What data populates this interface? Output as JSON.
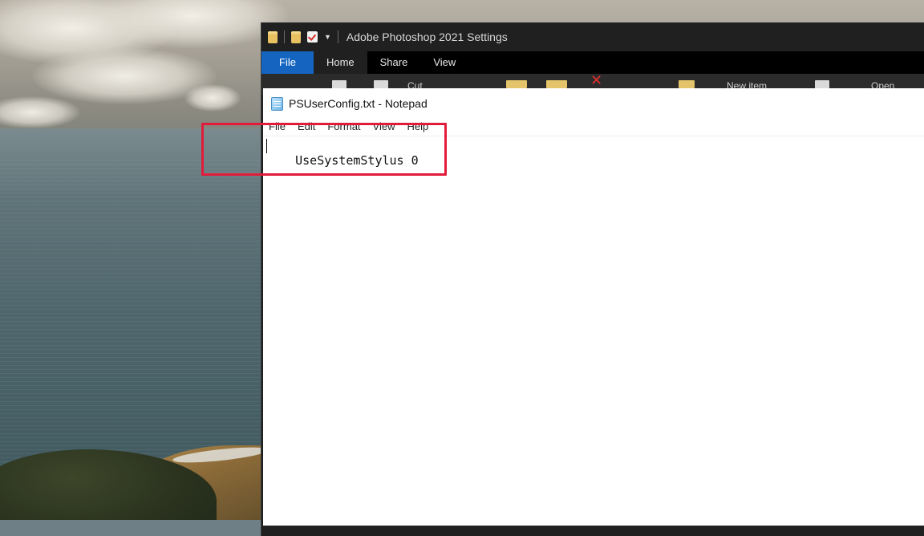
{
  "explorer": {
    "title": "Adobe Photoshop 2021 Settings",
    "tabs": [
      "File",
      "Home",
      "Share",
      "View"
    ],
    "ribbon": {
      "cut_label": "Cut",
      "new_item_label": "New item",
      "open_label": "Open"
    }
  },
  "notepad": {
    "title": "PSUserConfig.txt - Notepad",
    "menu": [
      "File",
      "Edit",
      "Format",
      "View",
      "Help"
    ],
    "content": "UseSystemStylus 0"
  },
  "colors": {
    "highlight": "#e21b3a",
    "file_tab": "#1565c0",
    "explorer_bg": "#202020"
  }
}
